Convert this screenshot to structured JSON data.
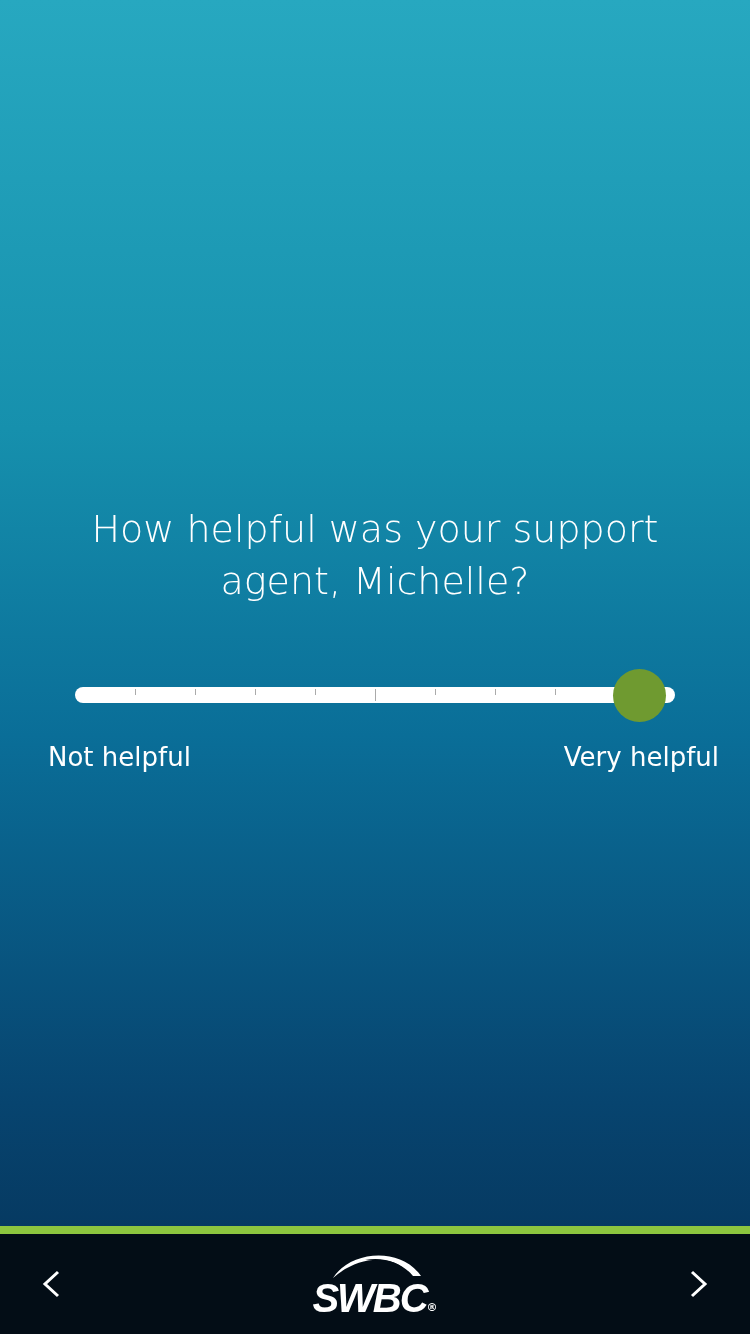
{
  "question": "How helpful was your support agent, Michelle?",
  "slider": {
    "level": 0.94,
    "min_label": "Not helpful",
    "max_label": "Very helpful"
  },
  "footer": {
    "logo_text": "SWBC",
    "logo_mark": "®"
  }
}
